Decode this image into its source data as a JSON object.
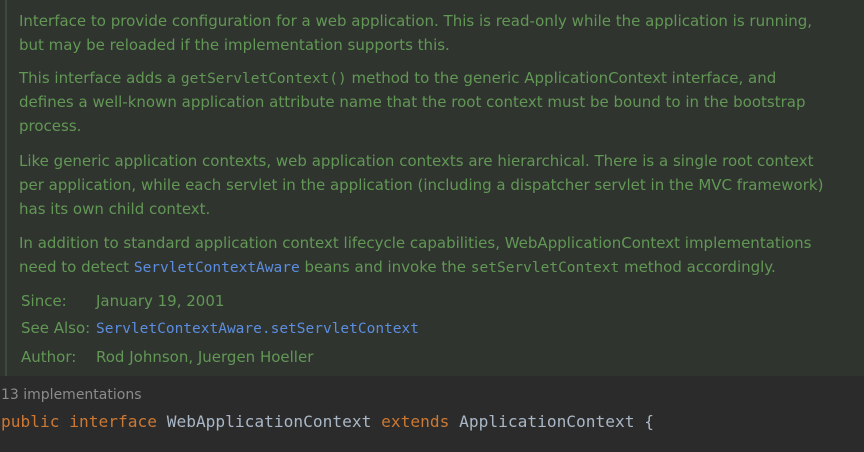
{
  "doc": {
    "p1": {
      "l1": "Interface to provide configuration for a web application. This is read-only while the application is running,",
      "l2": "but may be reloaded if the implementation supports this."
    },
    "p2": {
      "l1_a": "This interface adds a ",
      "l1_code": "getServletContext()",
      "l1_b": " method to the generic ApplicationContext interface, and",
      "l2": "defines a well-known application attribute name that the root context must be bound to in the bootstrap",
      "l3": "process."
    },
    "p3": {
      "l1": "Like generic application contexts, web application contexts are hierarchical. There is a single root context",
      "l2": "per application, while each servlet in the application (including a dispatcher servlet in the MVC framework)",
      "l3": "has its own child context."
    },
    "p4": {
      "l1": "In addition to standard application context lifecycle capabilities, WebApplicationContext implementations",
      "l2_a": "need to detect ",
      "l2_link": "ServletContextAware",
      "l2_b": " beans and invoke the ",
      "l2_code": "setServletContext",
      "l2_c": " method accordingly."
    },
    "tags": {
      "since_label": "Since:",
      "since_value": "January 19, 2001",
      "see_label": "See Also:",
      "see_value": "ServletContextAware.setServletContext",
      "author_label": "Author:",
      "author_value": "Rod Johnson, Juergen Hoeller"
    }
  },
  "implementations": "13 implementations",
  "declaration": {
    "kw_public": "public",
    "kw_interface": "interface",
    "name": "WebApplicationContext",
    "kw_extends": "extends",
    "parent": "ApplicationContext",
    "brace": "{"
  },
  "colors": {
    "background": "#2b2b2b",
    "doc_background": "#2f342f",
    "doc_text": "#629755",
    "doc_link": "#5c8de0",
    "keyword": "#cc7832",
    "identifier": "#a9b7c6",
    "hint": "#8c8c8c"
  }
}
